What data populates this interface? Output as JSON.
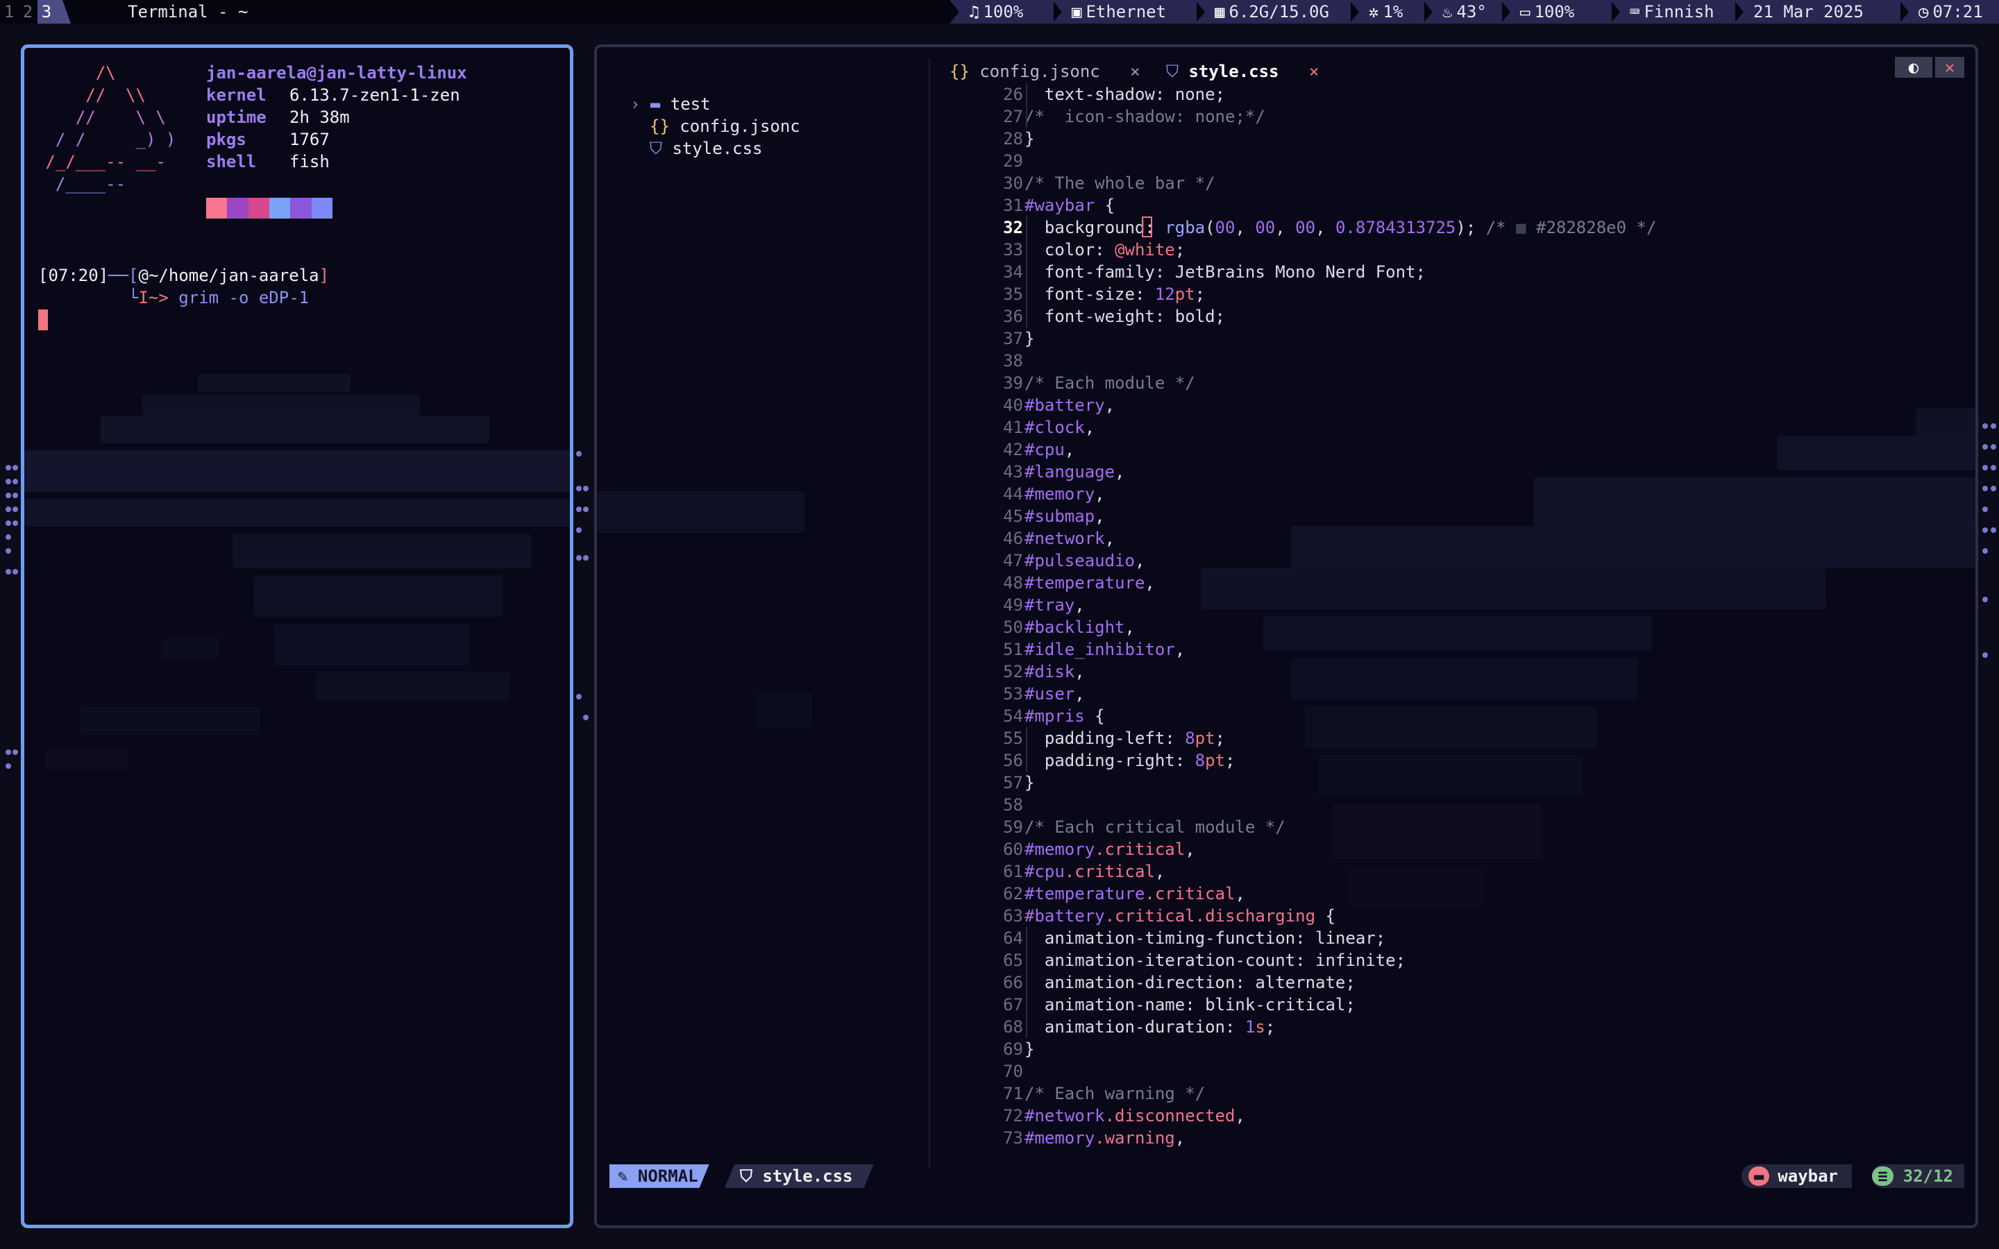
{
  "topbar": {
    "workspaces": [
      "1",
      "2",
      "3"
    ],
    "active_workspace": "3",
    "window_title": "Terminal - ~",
    "modules": [
      {
        "icon": "headphones-icon",
        "glyph": "♫",
        "text": "100%"
      },
      {
        "icon": "ethernet-icon",
        "glyph": "▣",
        "text": "Ethernet"
      },
      {
        "icon": "memory-icon",
        "glyph": "▦",
        "text": "6.2G/15.0G"
      },
      {
        "icon": "cpu-icon",
        "glyph": "✲",
        "text": "1%"
      },
      {
        "icon": "thermometer-icon",
        "glyph": "♨",
        "text": "43°"
      },
      {
        "icon": "battery-icon",
        "glyph": "▭",
        "text": "100%"
      },
      {
        "icon": "keyboard-icon",
        "glyph": "⌨",
        "text": "Finnish"
      },
      {
        "icon": "calendar-icon",
        "glyph": "",
        "text": "21 Mar 2025"
      },
      {
        "icon": "clock-icon",
        "glyph": "◷",
        "text": "07:21"
      }
    ]
  },
  "terminal": {
    "ascii_art": [
      "      /\\",
      "     //  \\\\",
      "    //    \\ \\",
      "  / /     _) )",
      " /_/___-- __-",
      "  /____--"
    ],
    "user_host": "jan-aarela@jan-latty-linux",
    "info": [
      {
        "key": "kernel",
        "value": "6.13.7-zen1-1-zen"
      },
      {
        "key": "uptime",
        "value": "2h 38m"
      },
      {
        "key": "pkgs",
        "value": "1767"
      },
      {
        "key": "shell",
        "value": "fish"
      }
    ],
    "palette": [
      "#f7768e",
      "#9b47c4",
      "#d6478e",
      "#7aa2f7",
      "#8a57dd",
      "#7d89f5"
    ],
    "prompt_time": "[07:20]",
    "prompt_connector": "──[",
    "prompt_path": "@~/home/jan-aarela",
    "prompt_path_close": "]",
    "prompt_arrow": "└",
    "prompt_indicator": "I~>",
    "command": "grim -o eDP-1"
  },
  "editor": {
    "tree": [
      {
        "icon": "folder-icon",
        "glyph": "▬",
        "name": "test",
        "expandable": true
      },
      {
        "icon": "json-file-icon",
        "glyph": "{}",
        "name": "config.jsonc"
      },
      {
        "icon": "css-file-icon",
        "glyph": "⛉",
        "name": "style.css"
      }
    ],
    "tabs": [
      {
        "icon": "{}",
        "name": "config.jsonc",
        "close": "×",
        "active": false
      },
      {
        "icon": "⛉",
        "name": "style.css",
        "close": "×",
        "active": true
      }
    ],
    "current_line": 32,
    "lines": [
      {
        "n": 26,
        "segs": [
          [
            "p",
            "  text-shadow: none;"
          ]
        ]
      },
      {
        "n": 27,
        "segs": [
          [
            "c",
            "/*  icon-shadow: none;*/"
          ]
        ]
      },
      {
        "n": 28,
        "segs": [
          [
            "p",
            "}"
          ]
        ]
      },
      {
        "n": 29,
        "segs": []
      },
      {
        "n": 30,
        "segs": [
          [
            "c",
            "/* The whole bar */"
          ]
        ]
      },
      {
        "n": 31,
        "segs": [
          [
            "s",
            "#waybar"
          ],
          [
            "p",
            " {"
          ]
        ]
      },
      {
        "n": 32,
        "segs": [
          [
            "p",
            "  background: "
          ],
          [
            "f",
            "rgba"
          ],
          [
            "p",
            "("
          ],
          [
            "n",
            "00"
          ],
          [
            "p",
            ", "
          ],
          [
            "n",
            "00"
          ],
          [
            "p",
            ", "
          ],
          [
            "n",
            "00"
          ],
          [
            "p",
            ", "
          ],
          [
            "n",
            "0.8784313725"
          ],
          [
            "p",
            "); "
          ],
          [
            "c",
            "/* "
          ],
          [
            "k",
            "■"
          ],
          [
            "c",
            " #282828e0 */"
          ]
        ]
      },
      {
        "n": 33,
        "segs": [
          [
            "p",
            "  color: "
          ],
          [
            "v",
            "@white"
          ],
          [
            "p",
            ";"
          ]
        ]
      },
      {
        "n": 34,
        "segs": [
          [
            "p",
            "  font-family: JetBrains Mono Nerd Font;"
          ]
        ]
      },
      {
        "n": 35,
        "segs": [
          [
            "p",
            "  font-size: "
          ],
          [
            "n",
            "12"
          ],
          [
            "v",
            "pt"
          ],
          [
            "p",
            ";"
          ]
        ]
      },
      {
        "n": 36,
        "segs": [
          [
            "p",
            "  font-weight: bold;"
          ]
        ]
      },
      {
        "n": 37,
        "segs": [
          [
            "p",
            "}"
          ]
        ]
      },
      {
        "n": 38,
        "segs": []
      },
      {
        "n": 39,
        "segs": [
          [
            "c",
            "/* Each module */"
          ]
        ]
      },
      {
        "n": 40,
        "segs": [
          [
            "s",
            "#battery"
          ],
          [
            "p",
            ","
          ]
        ]
      },
      {
        "n": 41,
        "segs": [
          [
            "s",
            "#clock"
          ],
          [
            "p",
            ","
          ]
        ]
      },
      {
        "n": 42,
        "segs": [
          [
            "s",
            "#cpu"
          ],
          [
            "p",
            ","
          ]
        ]
      },
      {
        "n": 43,
        "segs": [
          [
            "s",
            "#language"
          ],
          [
            "p",
            ","
          ]
        ]
      },
      {
        "n": 44,
        "segs": [
          [
            "s",
            "#memory"
          ],
          [
            "p",
            ","
          ]
        ]
      },
      {
        "n": 45,
        "segs": [
          [
            "s",
            "#submap"
          ],
          [
            "p",
            ","
          ]
        ]
      },
      {
        "n": 46,
        "segs": [
          [
            "s",
            "#network"
          ],
          [
            "p",
            ","
          ]
        ]
      },
      {
        "n": 47,
        "segs": [
          [
            "s",
            "#pulseaudio"
          ],
          [
            "p",
            ","
          ]
        ]
      },
      {
        "n": 48,
        "segs": [
          [
            "s",
            "#temperature"
          ],
          [
            "p",
            ","
          ]
        ]
      },
      {
        "n": 49,
        "segs": [
          [
            "s",
            "#tray"
          ],
          [
            "p",
            ","
          ]
        ]
      },
      {
        "n": 50,
        "segs": [
          [
            "s",
            "#backlight"
          ],
          [
            "p",
            ","
          ]
        ]
      },
      {
        "n": 51,
        "segs": [
          [
            "s",
            "#idle_inhibitor"
          ],
          [
            "p",
            ","
          ]
        ]
      },
      {
        "n": 52,
        "segs": [
          [
            "s",
            "#disk"
          ],
          [
            "p",
            ","
          ]
        ]
      },
      {
        "n": 53,
        "segs": [
          [
            "s",
            "#user"
          ],
          [
            "p",
            ","
          ]
        ]
      },
      {
        "n": 54,
        "segs": [
          [
            "s",
            "#mpris"
          ],
          [
            "p",
            " {"
          ]
        ]
      },
      {
        "n": 55,
        "segs": [
          [
            "p",
            "  padding-left: "
          ],
          [
            "n",
            "8"
          ],
          [
            "v",
            "pt"
          ],
          [
            "p",
            ";"
          ]
        ]
      },
      {
        "n": 56,
        "segs": [
          [
            "p",
            "  padding-right: "
          ],
          [
            "n",
            "8"
          ],
          [
            "v",
            "pt"
          ],
          [
            "p",
            ";"
          ]
        ]
      },
      {
        "n": 57,
        "segs": [
          [
            "p",
            "}"
          ]
        ]
      },
      {
        "n": 58,
        "segs": []
      },
      {
        "n": 59,
        "segs": [
          [
            "c",
            "/* Each critical module */"
          ]
        ]
      },
      {
        "n": 60,
        "segs": [
          [
            "s",
            "#memory"
          ],
          [
            "x",
            ".critical"
          ],
          [
            "p",
            ","
          ]
        ]
      },
      {
        "n": 61,
        "segs": [
          [
            "s",
            "#cpu"
          ],
          [
            "x",
            ".critical"
          ],
          [
            "p",
            ","
          ]
        ]
      },
      {
        "n": 62,
        "segs": [
          [
            "s",
            "#temperature"
          ],
          [
            "x",
            ".critical"
          ],
          [
            "p",
            ","
          ]
        ]
      },
      {
        "n": 63,
        "segs": [
          [
            "s",
            "#battery"
          ],
          [
            "x",
            ".critical.discharging"
          ],
          [
            "p",
            " {"
          ]
        ]
      },
      {
        "n": 64,
        "segs": [
          [
            "p",
            "  animation-timing-function: linear;"
          ]
        ]
      },
      {
        "n": 65,
        "segs": [
          [
            "p",
            "  animation-iteration-count: infinite;"
          ]
        ]
      },
      {
        "n": 66,
        "segs": [
          [
            "p",
            "  animation-direction: alternate;"
          ]
        ]
      },
      {
        "n": 67,
        "segs": [
          [
            "p",
            "  animation-name: blink-critical;"
          ]
        ]
      },
      {
        "n": 68,
        "segs": [
          [
            "p",
            "  animation-duration: "
          ],
          [
            "n",
            "1"
          ],
          [
            "v",
            "s"
          ],
          [
            "p",
            ";"
          ]
        ]
      },
      {
        "n": 69,
        "segs": [
          [
            "p",
            "}"
          ]
        ]
      },
      {
        "n": 70,
        "segs": []
      },
      {
        "n": 71,
        "segs": [
          [
            "c",
            "/* Each warning */"
          ]
        ]
      },
      {
        "n": 72,
        "segs": [
          [
            "s",
            "#network"
          ],
          [
            "x",
            ".disconnected"
          ],
          [
            "p",
            ","
          ]
        ]
      },
      {
        "n": 73,
        "segs": [
          [
            "s",
            "#memory"
          ],
          [
            "x",
            ".warning"
          ],
          [
            "p",
            ","
          ]
        ]
      }
    ],
    "status": {
      "mode": "NORMAL",
      "file": "style.css",
      "project": "waybar",
      "position": "32/12"
    },
    "window_controls": {
      "toggle": "◐",
      "close": "✕"
    }
  },
  "colors": {
    "accent_border": "#6e9ef2",
    "mode_bg": "#8aa0f0",
    "project_bg": "#f07682",
    "position_bg": "#7cc28a"
  }
}
